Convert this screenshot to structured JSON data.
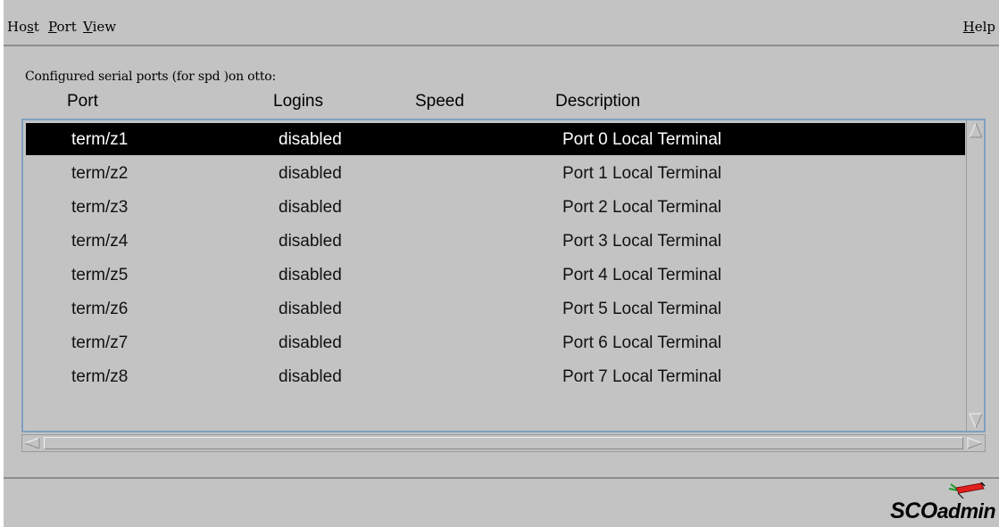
{
  "menubar": {
    "host": {
      "pre": "Ho",
      "u": "s",
      "post": "t"
    },
    "port": {
      "pre": "",
      "u": "P",
      "post": "ort"
    },
    "view": {
      "pre": "",
      "u": "V",
      "post": "iew"
    },
    "help": {
      "pre": "",
      "u": "H",
      "post": "elp"
    }
  },
  "caption": "Configured serial ports (for spd )on otto:",
  "columns": {
    "port": "Port",
    "logins": "Logins",
    "speed": "Speed",
    "description": "Description"
  },
  "rows": [
    {
      "port": "term/z1",
      "logins": "disabled",
      "speed": "",
      "description": "Port 0 Local Terminal"
    },
    {
      "port": "term/z2",
      "logins": "disabled",
      "speed": "",
      "description": "Port 1 Local Terminal"
    },
    {
      "port": "term/z3",
      "logins": "disabled",
      "speed": "",
      "description": "Port 2 Local Terminal"
    },
    {
      "port": "term/z4",
      "logins": "disabled",
      "speed": "",
      "description": "Port 3 Local Terminal"
    },
    {
      "port": "term/z5",
      "logins": "disabled",
      "speed": "",
      "description": "Port 4 Local Terminal"
    },
    {
      "port": "term/z6",
      "logins": "disabled",
      "speed": "",
      "description": "Port 5 Local Terminal"
    },
    {
      "port": "term/z7",
      "logins": "disabled",
      "speed": "",
      "description": "Port 6 Local Terminal"
    },
    {
      "port": "term/z8",
      "logins": "disabled",
      "speed": "",
      "description": "Port 7 Local Terminal"
    }
  ],
  "selected_row": 0,
  "logo": {
    "brand": "SCO",
    "product": "admin"
  },
  "icons": {
    "scroll_up": "triangle-up-icon",
    "scroll_down": "triangle-down-icon",
    "scroll_left": "triangle-left-icon",
    "scroll_right": "triangle-right-icon",
    "logo": "sco-logo-icon"
  },
  "colors": {
    "window_bg": "#c3c3c3",
    "selection_bg": "#000000",
    "selection_fg": "#ffffff",
    "list_border": "#7ea0bf",
    "logo_red": "#e0201e",
    "logo_green": "#1a9a2a"
  }
}
